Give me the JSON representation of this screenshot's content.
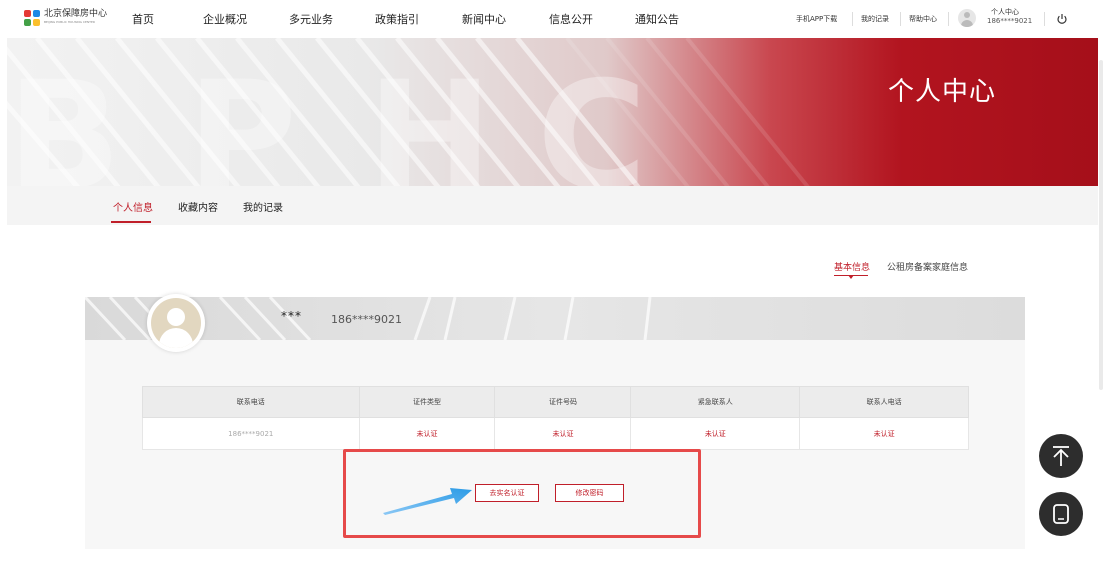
{
  "header": {
    "logo_text": "北京保障房中心",
    "logo_subtext": "BEIJING PUBLIC HOUSING CENTER",
    "nav": [
      "首页",
      "企业概况",
      "多元业务",
      "政策指引",
      "新闻中心",
      "信息公开",
      "通知公告"
    ],
    "right_links": [
      "手机APP下载",
      "我的记录",
      "帮助中心"
    ],
    "user_label": "个人中心",
    "user_phone": "186****9021",
    "icons": {
      "user": "avatar-icon",
      "power": "power-icon"
    }
  },
  "banner": {
    "title": "个人中心",
    "bg_letters": [
      "B",
      "P",
      "H",
      "C"
    ],
    "accent_color": "#c01f2a"
  },
  "tabs": [
    "个人信息",
    "收藏内容",
    "我的记录"
  ],
  "active_tab": "个人信息",
  "subtabs": [
    "基本信息",
    "公租房备案家庭信息"
  ],
  "active_subtab": "基本信息",
  "profile": {
    "name": "***",
    "phone": "186****9021"
  },
  "table": {
    "headers": [
      "联系电话",
      "证件类型",
      "证件号码",
      "紧急联系人",
      "联系人电话"
    ],
    "row": [
      "186****9021",
      "未认证",
      "未认证",
      "未认证",
      "未认证"
    ]
  },
  "buttons": {
    "real_name": "去实名认证",
    "change_password": "修改密码"
  },
  "float_buttons": {
    "top": "back-to-top-icon",
    "feedback": "chat-icon"
  },
  "colors": {
    "brand_red": "#c01f2a",
    "annotation_red": "#e64a4a",
    "annotation_arrow": "#2b9be6"
  }
}
